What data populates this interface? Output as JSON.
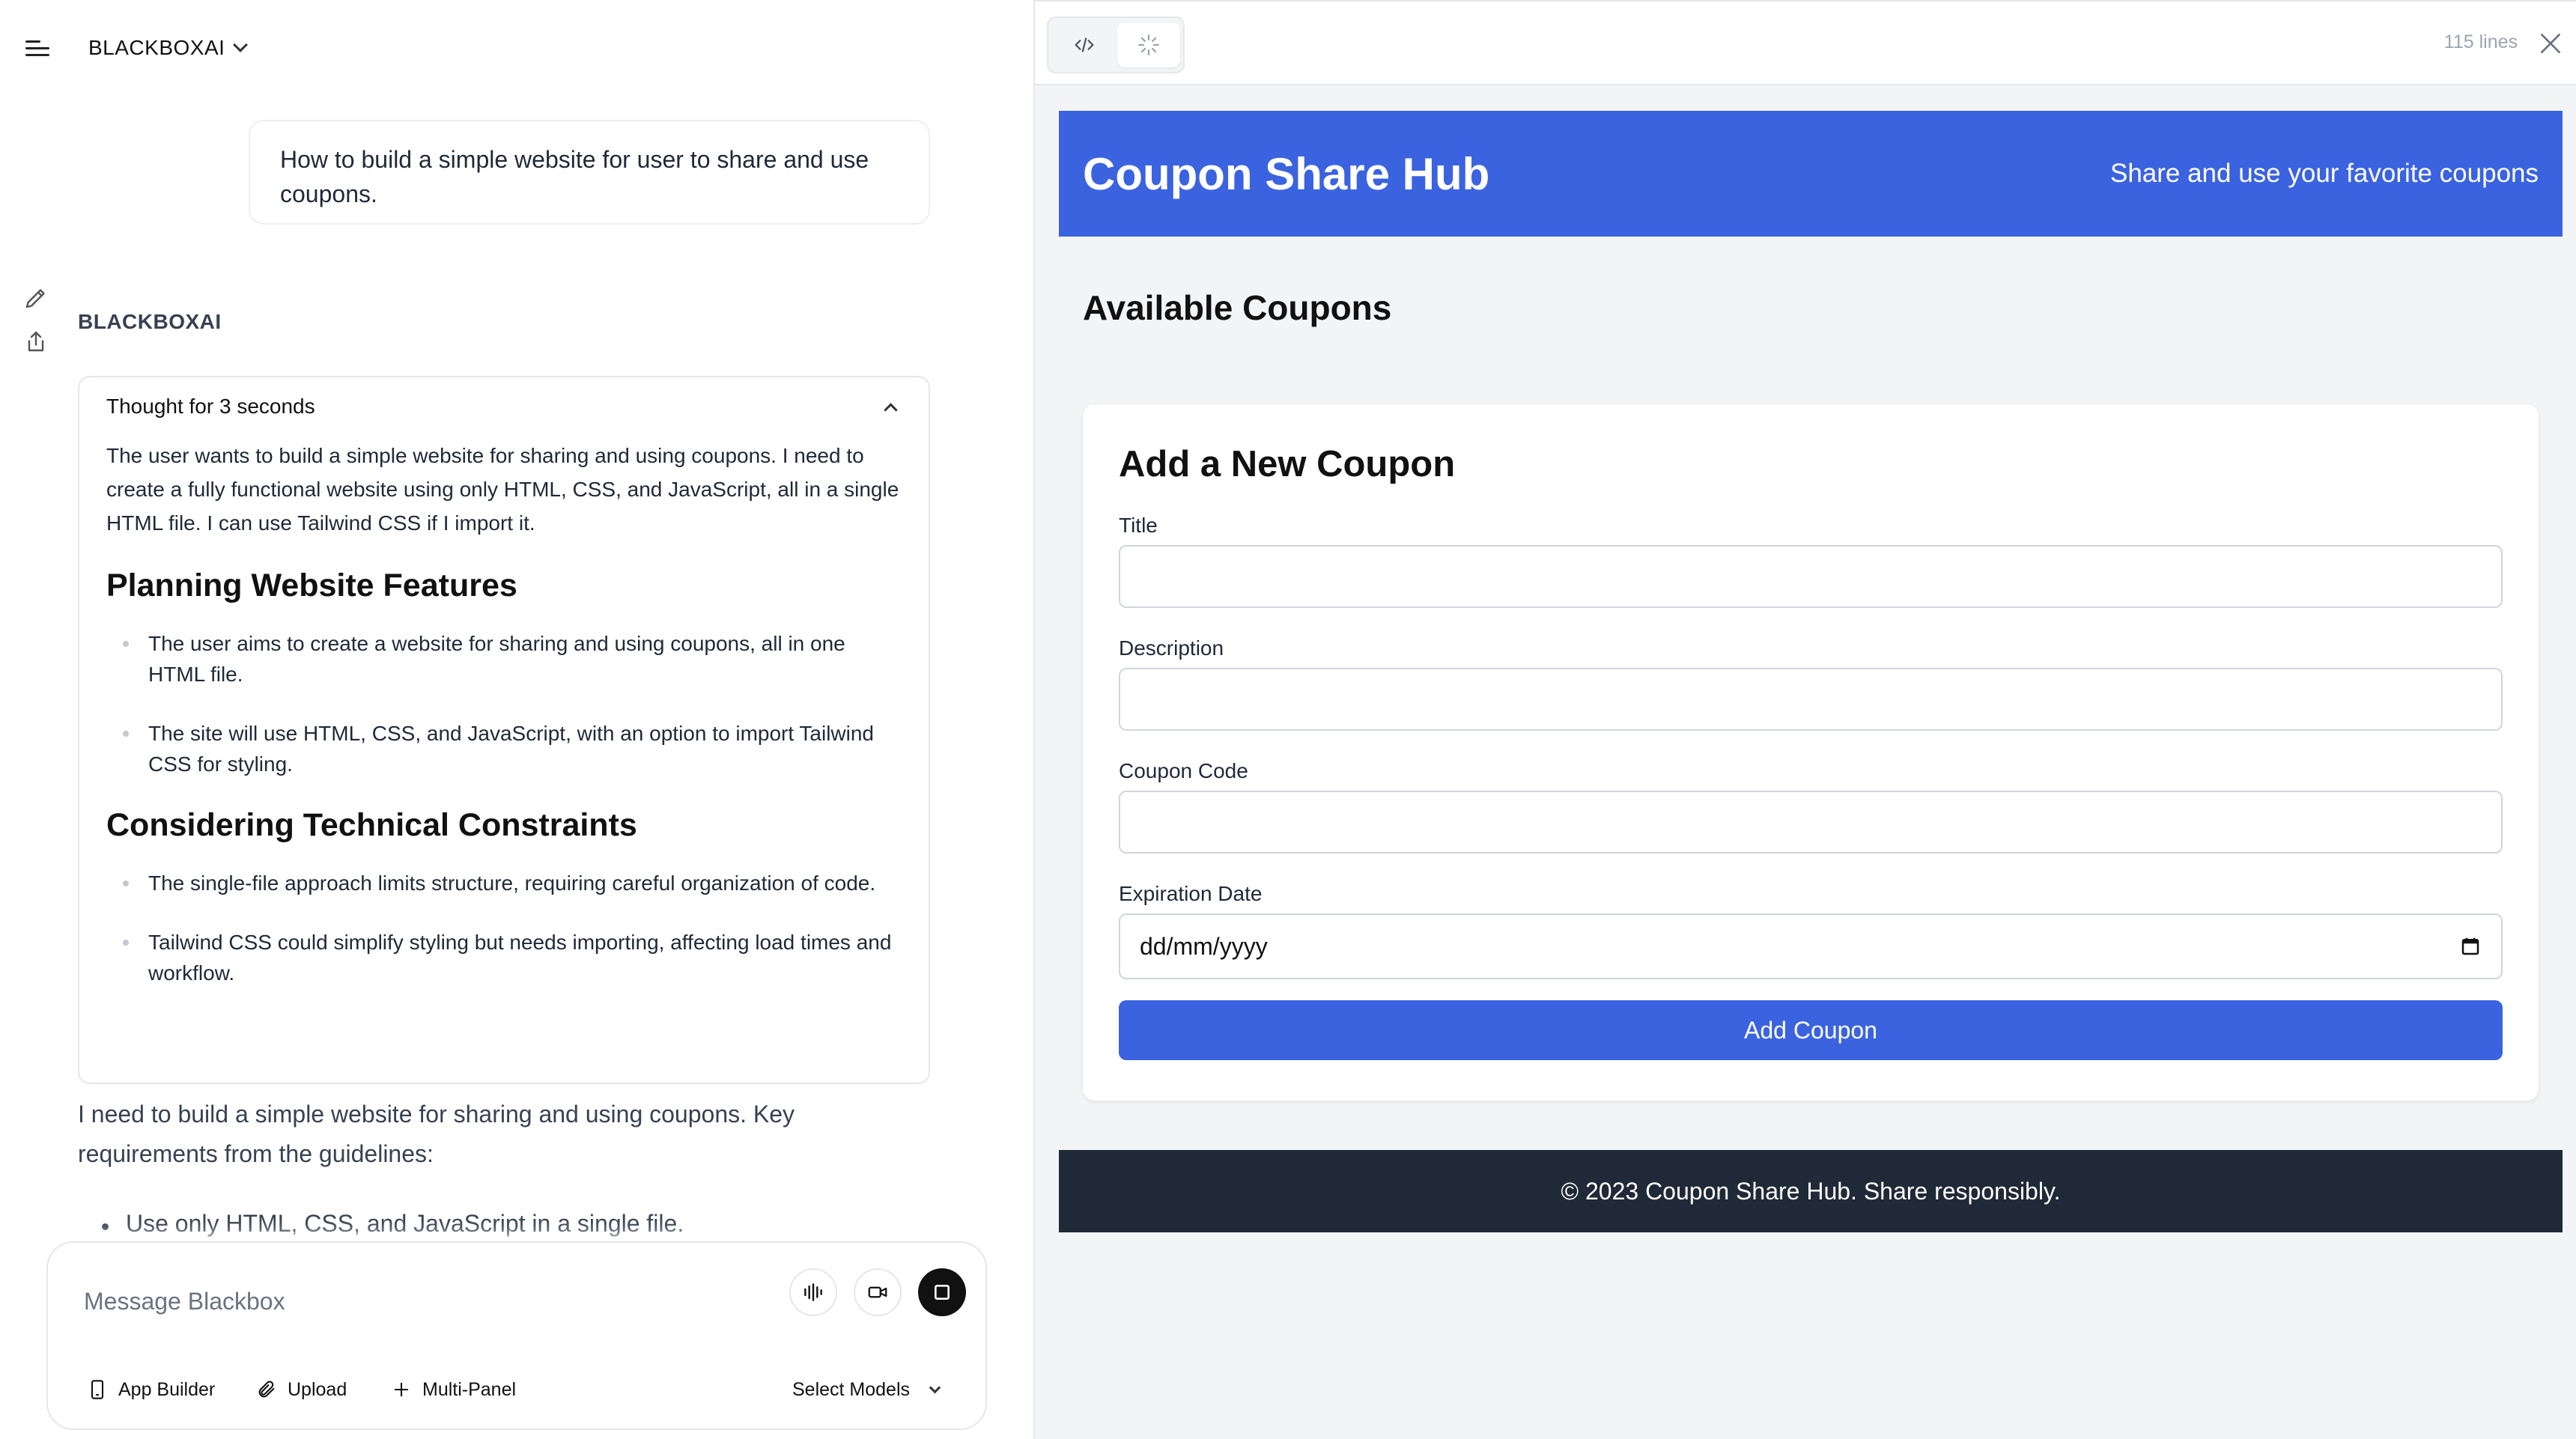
{
  "brand": {
    "name": "BLACKBOXAI"
  },
  "chat": {
    "user_message": "How to build a simple website for user to share and use coupons.",
    "bot_name": "BLACKBOXAI",
    "thought": {
      "title": "Thought for 3 seconds",
      "intro": "The user wants to build a simple website for sharing and using coupons. I need to create a fully functional website using only HTML, CSS, and JavaScript, all in a single HTML file. I can use Tailwind CSS if I import it.",
      "sections": [
        {
          "heading": "Planning Website Features",
          "bullets": [
            "The user aims to create a website for sharing and using coupons, all in one HTML file.",
            "The site will use HTML, CSS, and JavaScript, with an option to import Tailwind CSS for styling."
          ]
        },
        {
          "heading": "Considering Technical Constraints",
          "bullets": [
            "The single-file approach limits structure, requiring careful organization of code.",
            "Tailwind CSS could simplify styling but needs importing, affecting load times and workflow."
          ]
        }
      ]
    },
    "response_text": "I need to build a simple website for sharing and using coupons. Key requirements from the guidelines:",
    "response_bullet": "Use only HTML, CSS, and JavaScript in a single file."
  },
  "composer": {
    "placeholder": "Message Blackbox",
    "tools": {
      "app_builder": "App Builder",
      "upload": "Upload",
      "multi_panel": "Multi-Panel",
      "select_models": "Select Models"
    }
  },
  "preview_panel": {
    "lines_count": "115 lines",
    "site": {
      "title": "Coupon Share Hub",
      "tagline": "Share and use your favorite coupons",
      "coupons_heading": "Available Coupons",
      "form": {
        "title": "Add a New Coupon",
        "title_label": "Title",
        "description_label": "Description",
        "code_label": "Coupon Code",
        "expiration_label": "Expiration Date",
        "date_placeholder": "dd/mm/yyyy",
        "submit_label": "Add Coupon"
      },
      "footer": "© 2023 Coupon Share Hub. Share responsibly."
    }
  },
  "colors": {
    "accent_blue": "#3b63e0",
    "footer_dark": "#1f2937",
    "preview_bg": "#f3f4f6"
  }
}
